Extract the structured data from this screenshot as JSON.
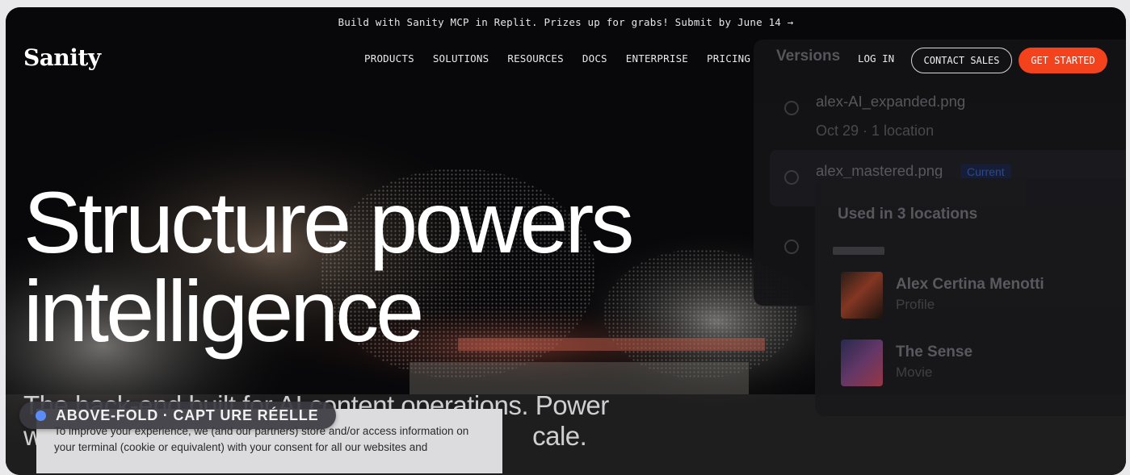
{
  "banner": {
    "text": "Build with Sanity MCP in Replit. Prizes up for grabs! Submit by June 14 →"
  },
  "nav": {
    "logo": "Sanity",
    "items": [
      {
        "label": "PRODUCTS"
      },
      {
        "label": "SOLUTIONS"
      },
      {
        "label": "RESOURCES"
      },
      {
        "label": "DOCS"
      },
      {
        "label": "ENTERPRISE"
      },
      {
        "label": "PRICING"
      }
    ],
    "login": "LOG IN",
    "contact": "CONTACT SALES",
    "start": "GET STARTED"
  },
  "versions_panel": {
    "title": "Versions",
    "items": [
      {
        "name": "alex-AI_expanded.png",
        "meta": "Oct 29 · 1 location"
      },
      {
        "name": "alex_mastered.png",
        "badge": "Current"
      }
    ],
    "usage": {
      "title": "Used in 3 locations",
      "locations": [
        {
          "name": "Alex Certina Menotti",
          "type": "Profile"
        },
        {
          "name": "The Sense",
          "type": "Movie"
        }
      ]
    }
  },
  "hero": {
    "line1": "Structure powers",
    "line2": "intelligence",
    "subtitle_line1": "The back-end built for AI content operations. Power",
    "subtitle_line2": "w                                                                      cale."
  },
  "cookie": {
    "text": "To improve your experience, we (and our partners) store and/or access information on your terminal (cookie or equivalent) with your consent for all our websites and"
  },
  "overlay_pill": {
    "text": "ABOVE-FOLD · CAPT URE RÉELLE"
  },
  "colors": {
    "accent": "#f4421c",
    "pill_dot": "#5b8dfa",
    "background": "#08080a"
  }
}
